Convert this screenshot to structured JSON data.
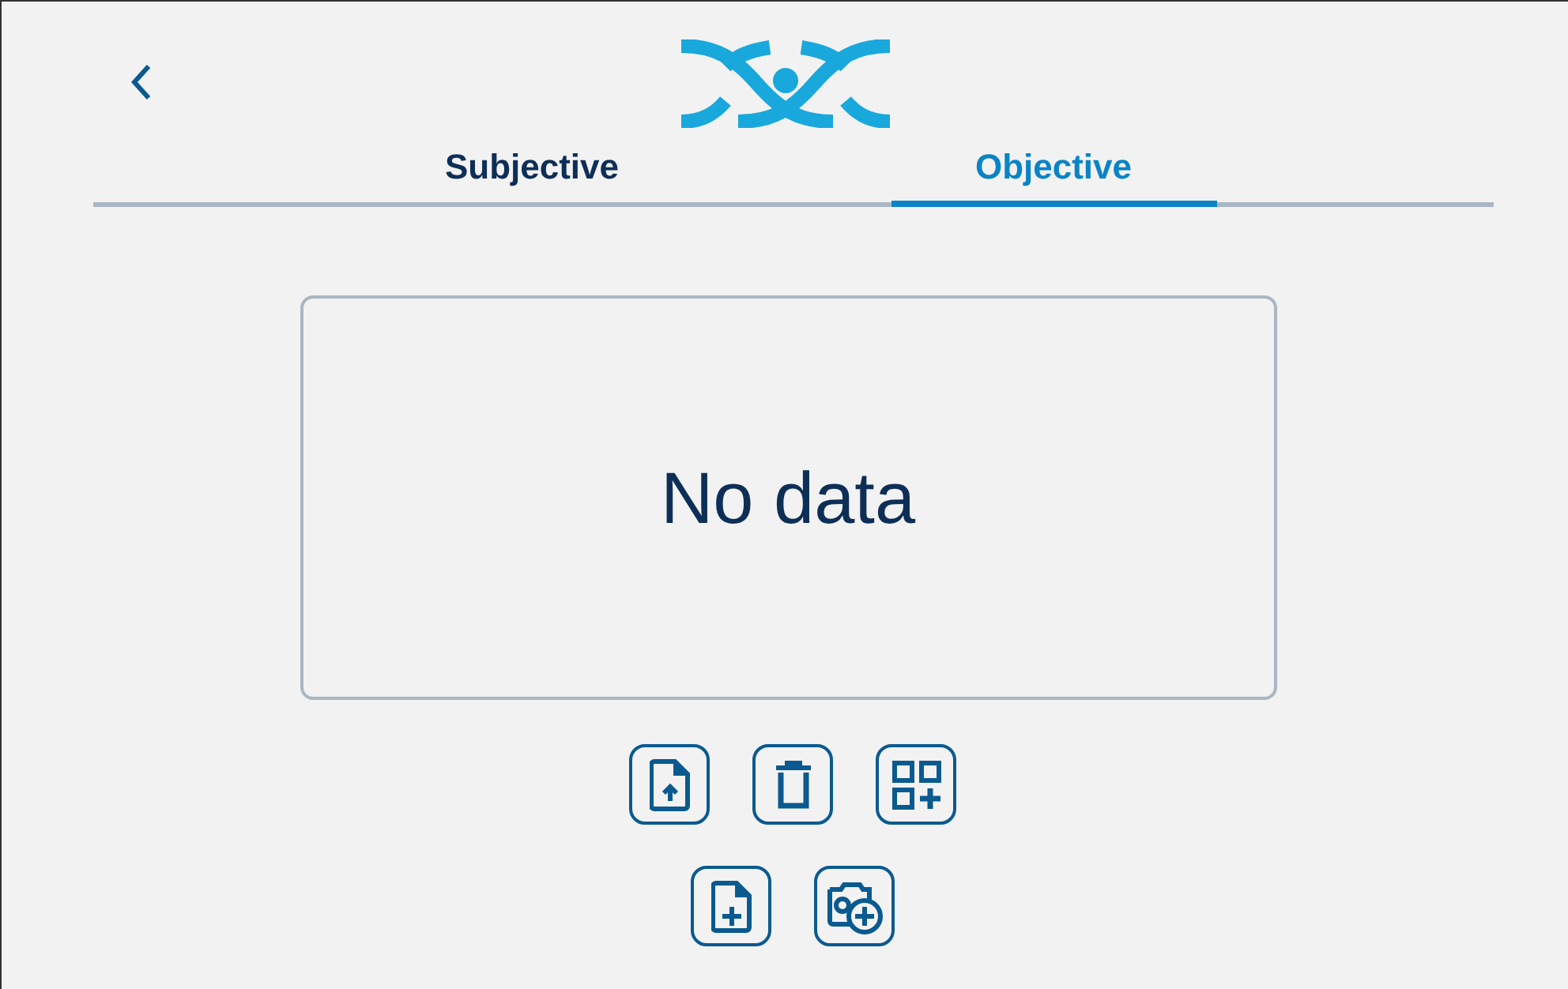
{
  "tabs": [
    {
      "label": "Subjective",
      "selected": false
    },
    {
      "label": "Objective",
      "selected": true
    }
  ],
  "content": {
    "message": "No data"
  },
  "action_rows": [
    [
      {
        "kind": "upload"
      },
      {
        "kind": "trash"
      },
      {
        "kind": "grid-add"
      }
    ],
    [
      {
        "kind": "file-add"
      },
      {
        "kind": "camera-add"
      }
    ]
  ]
}
